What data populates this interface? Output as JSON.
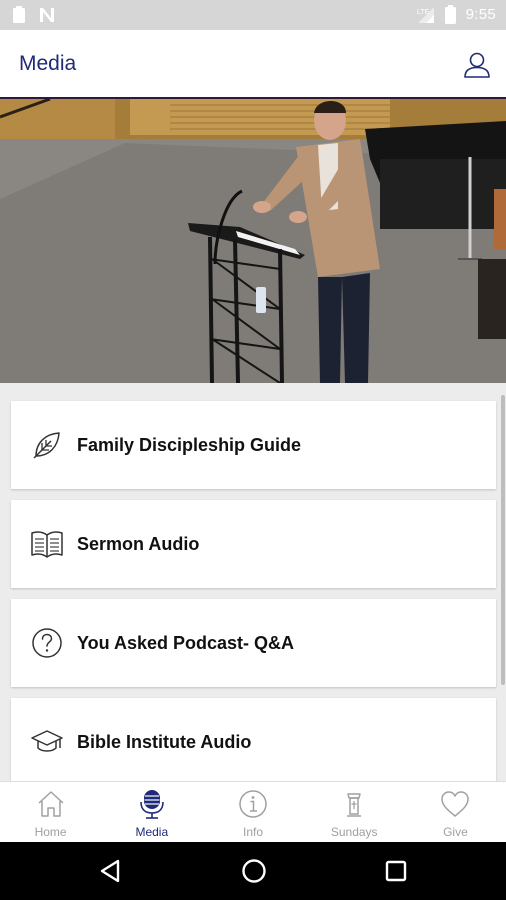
{
  "status_bar": {
    "time": "9:55",
    "icons": [
      "clipboard-icon",
      "n-notification-icon",
      "signal-icon",
      "battery-icon"
    ]
  },
  "app_bar": {
    "title": "Media",
    "title_color": "#1f2a78",
    "profile_icon": "person-outline-icon"
  },
  "hero": {
    "image": "photo of preacher speaking at a lectern on stage"
  },
  "media_list": {
    "items": [
      {
        "label": "Family Discipleship Guide",
        "icon": "leaf-icon"
      },
      {
        "label": "Sermon Audio",
        "icon": "open-book-icon"
      },
      {
        "label": "You Asked Podcast- Q&A",
        "icon": "question-circle-icon"
      },
      {
        "label": "Bible Institute Audio",
        "icon": "graduation-cap-icon"
      }
    ]
  },
  "bottom_nav": {
    "items": [
      {
        "label": "Home",
        "icon": "home-icon",
        "active": false
      },
      {
        "label": "Media",
        "icon": "microphone-icon",
        "active": true
      },
      {
        "label": "Info",
        "icon": "info-icon",
        "active": false
      },
      {
        "label": "Sundays",
        "icon": "pulpit-icon",
        "active": false
      },
      {
        "label": "Give",
        "icon": "heart-icon",
        "active": false
      }
    ],
    "active_color": "#1f2a78",
    "inactive_color": "#a0a0a0"
  },
  "system_nav": {
    "buttons": [
      "back-icon",
      "home-circle-icon",
      "recents-icon"
    ]
  }
}
